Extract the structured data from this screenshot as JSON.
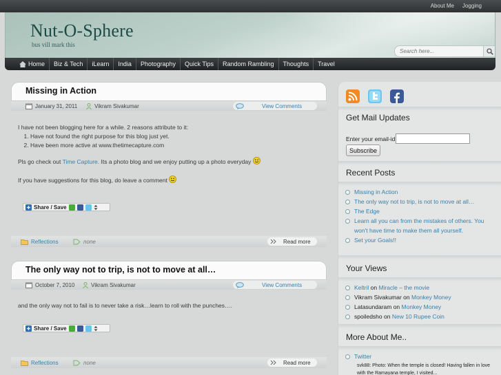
{
  "toplinks": [
    "About Me",
    "Jogging"
  ],
  "site": {
    "title": "Nut-O-Sphere",
    "tagline": "bus vill mark this"
  },
  "search": {
    "placeholder": "Search here..."
  },
  "nav": [
    "Home",
    "Biz & Tech",
    "iLearn",
    "India",
    "Photography",
    "Quick Tips",
    "Random Rambling",
    "Thoughts",
    "Travel"
  ],
  "posts": [
    {
      "title": "Missing in Action",
      "date": "January 31, 2011",
      "author": "Vikram Sivakumar",
      "comments_label": "View Comments",
      "body_line1": "I have not been blogging here for a while. 2 reasons attribute to it:",
      "list": [
        "Have not found the right purpose for this blog just yet.",
        "Have been more active at www.thetimecapture.com"
      ],
      "para2_a": "Pls go check out ",
      "para2_link": "Time Capture.",
      "para2_b": " Its a photo blog and we enjoy putting up a photo everyday",
      "para3": "If you have suggestions for this blog, do leave a comment",
      "share_label": "Share / Save",
      "category": "Reflections",
      "tags": "none",
      "readmore": "Read more"
    },
    {
      "title": "The only way not to trip, is not to move at all…",
      "date": "October 7, 2010",
      "author": "Vikram Sivakumar",
      "comments_label": "View Comments",
      "body": "and the only way not to fail is to never take a risk…learn to roll with the punches….",
      "share_label": "Share / Save",
      "category": "Reflections",
      "tags": "none",
      "readmore": "Read more"
    }
  ],
  "sidebar": {
    "mail": {
      "title": "Get Mail Updates",
      "label": "Enter your email-id",
      "button": "Subscribe"
    },
    "recent": {
      "title": "Recent Posts",
      "items": [
        "Missing in Action",
        "The only way not to trip, is not to move at all…",
        "The Edge",
        "Learn all you can from the mistakes of others. You won't have time to make them all yourself.",
        "Set your Goals!!"
      ]
    },
    "views": {
      "title": "Your Views",
      "items": [
        {
          "author": "Keltril",
          "on": " on ",
          "post": "Miracle – the movie",
          "author_link": true
        },
        {
          "author": "Vikram Sivakumar",
          "on": " on ",
          "post": "Monkey Money",
          "author_link": false
        },
        {
          "author": "Latasundaram",
          "on": " on ",
          "post": "Monkey Money",
          "author_link": false
        },
        {
          "author": "spoiledsho",
          "on": " on ",
          "post": "New 10 Rupee Coin",
          "author_link": false
        }
      ]
    },
    "about": {
      "title": "More About Me..",
      "twitter": "Twitter",
      "tweet": "svk88: Photo: When the temple is closed! Having fallen in love with the Ramayana temple, I visited..."
    }
  },
  "colors": {
    "link": "#3a7fa8",
    "nav_bg": "#2b2e30",
    "header_bg": "#b7cbc5"
  }
}
